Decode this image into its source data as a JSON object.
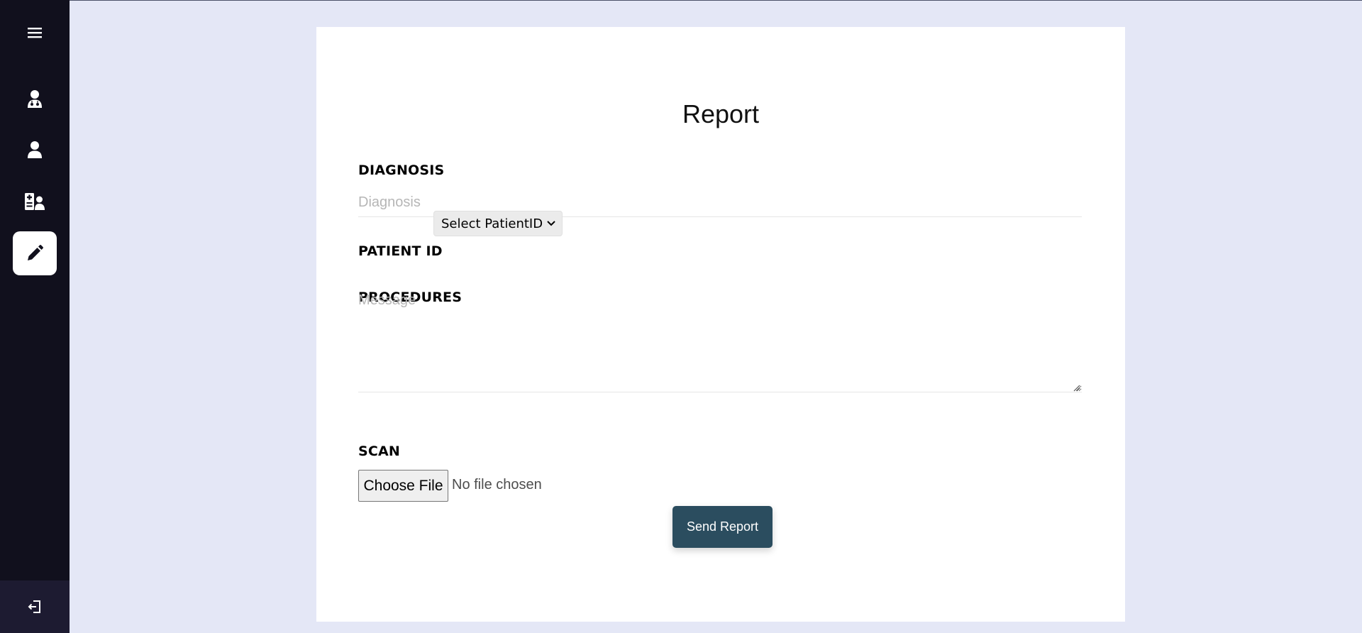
{
  "sidebar": {
    "icons": {
      "menu": "menu-icon",
      "doctor": "doctor-icon",
      "patient": "user-icon",
      "records": "medical-record-icon",
      "report": "pencil-icon",
      "logout": "logout-icon"
    },
    "active_item": "report"
  },
  "form": {
    "title": "Report",
    "diagnosis": {
      "label": "DIAGNOSIS",
      "placeholder": "Diagnosis",
      "value": ""
    },
    "patient_id": {
      "label": "PATIENT ID",
      "selected": "Select PatientID"
    },
    "procedures": {
      "label": "PROCEDURES",
      "placeholder": "Message",
      "value": ""
    },
    "scan": {
      "label": "SCAN",
      "button_label": "Choose File",
      "status": "No file chosen"
    },
    "submit_label": "Send Report"
  },
  "colors": {
    "page_background": "#e4e7f6",
    "sidebar_background": "#11101d",
    "sidebar_footer": "#1d1b31",
    "submit_button": "#2b4d5f"
  }
}
